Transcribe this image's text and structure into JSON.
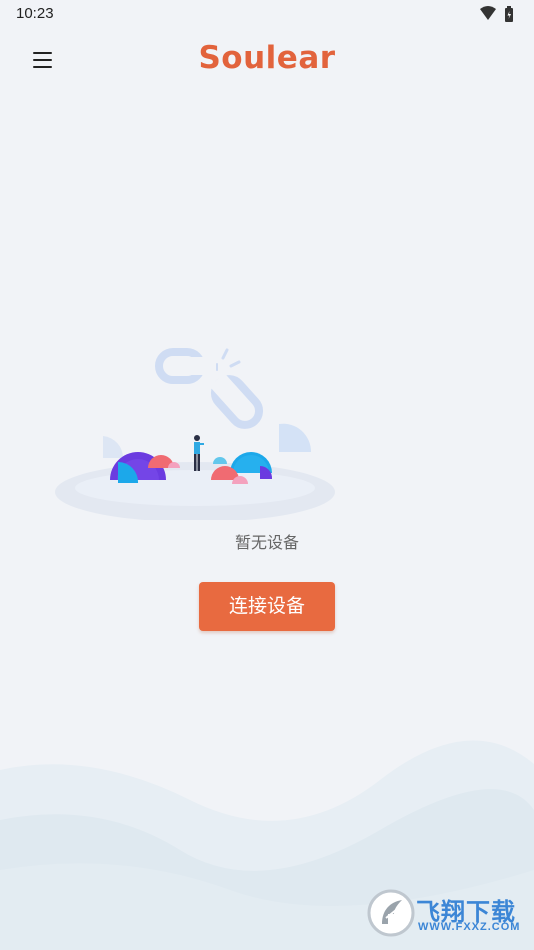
{
  "status_bar": {
    "time": "10:23"
  },
  "header": {
    "menu_icon": "hamburger-menu-icon",
    "logo_text": "Soulear"
  },
  "empty_state": {
    "illustration": "broken-link-illustration",
    "message": "暂无设备"
  },
  "actions": {
    "connect_label": "连接设备"
  },
  "watermark": {
    "title": "飞翔下载",
    "url": "WWW.FXXZ.COM"
  },
  "colors": {
    "background": "#F1F3F7",
    "brand": "#E2633C",
    "button": "#E86A40",
    "watermark": "#3C86D6"
  }
}
